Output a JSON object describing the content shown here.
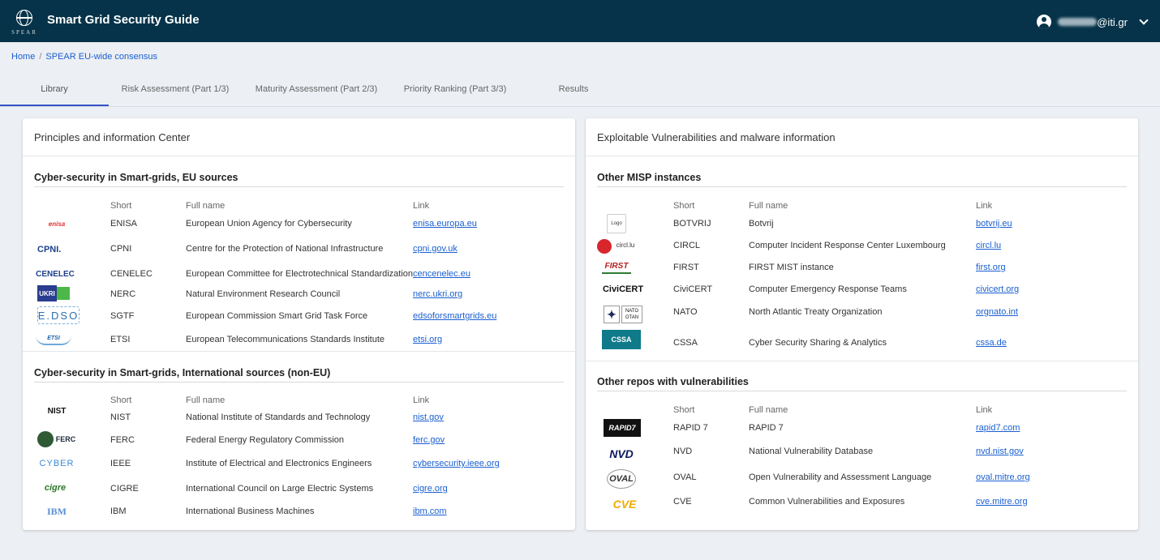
{
  "header": {
    "title": "Smart Grid Security Guide",
    "logo_text": "SPEAR",
    "user_suffix": "@iti.gr"
  },
  "breadcrumb": {
    "home": "Home",
    "separator": "/",
    "current": "SPEAR EU-wide consensus"
  },
  "tabs": [
    {
      "label": "Library"
    },
    {
      "label": "Risk Assessment (Part 1/3)"
    },
    {
      "label": "Maturity Assessment (Part 2/3)"
    },
    {
      "label": "Priority Ranking (Part 3/3)"
    },
    {
      "label": "Results"
    }
  ],
  "columns": {
    "short": "Short",
    "full": "Full name",
    "link": "Link"
  },
  "left_card": {
    "title": "Principles and information Center",
    "sections": [
      {
        "title": "Cyber-security in Smart-grids, EU sources",
        "rows": [
          {
            "logo": "enisa",
            "short": "ENISA",
            "full": "European Union Agency for Cybersecurity",
            "link": "enisa.europa.eu"
          },
          {
            "logo": "CPNI.",
            "short": "CPNI",
            "full": "Centre for the Protection of National Infrastructure",
            "link": "cpni.gov.uk"
          },
          {
            "logo": "CENELEC",
            "short": "CENELEC",
            "full": "European Committee for Electrotechnical Standardization",
            "link": "cencenelec.eu"
          },
          {
            "logo": "UKRI",
            "short": "NERC",
            "full": "Natural Environment Research Council",
            "link": "nerc.ukri.org"
          },
          {
            "logo": "E.DSO",
            "short": "SGTF",
            "full": "European Commission Smart Grid Task Force",
            "link": "edsoforsmartgrids.eu"
          },
          {
            "logo": "ETSI",
            "short": "ETSI",
            "full": "European Telecommunications Standards Institute",
            "link": "etsi.org"
          }
        ]
      },
      {
        "title": "Cyber-security in Smart-grids, International sources (non-EU)",
        "rows": [
          {
            "logo": "NIST",
            "short": "NIST",
            "full": "National Institute of Standards and Technology",
            "link": "nist.gov"
          },
          {
            "logo": "FERC",
            "short": "FERC",
            "full": "Federal Energy Regulatory Commission",
            "link": "ferc.gov"
          },
          {
            "logo": "CYBER",
            "short": "IEEE",
            "full": "Institute of Electrical and Electronics Engineers",
            "link": "cybersecurity.ieee.org"
          },
          {
            "logo": "cigre",
            "short": "CIGRE",
            "full": "International Council on Large Electric Systems",
            "link": "cigre.org"
          },
          {
            "logo": "IBM",
            "short": "IBM",
            "full": "International Business Machines",
            "link": "ibm.com"
          }
        ]
      }
    ]
  },
  "right_card": {
    "title": "Exploitable Vulnerabilities and malware information",
    "sections": [
      {
        "title": "Other MISP instances",
        "rows": [
          {
            "logo": "Logo",
            "short": "BOTVRIJ",
            "full": "Botvrij",
            "link": "botvrij.eu"
          },
          {
            "logo": "circl.lu",
            "short": "CIRCL",
            "full": "Computer Incident Response Center Luxembourg",
            "link": "circl.lu"
          },
          {
            "logo": "FIRST",
            "short": "FIRST",
            "full": "FIRST MIST instance",
            "link": "first.org"
          },
          {
            "logo": "CiviCERT",
            "short": "CiviCERT",
            "full": "Computer Emergency Response Teams",
            "link": "civicert.org"
          },
          {
            "logo": "NATO OTAN",
            "short": "NATO",
            "full": "North Atlantic Treaty Organization",
            "link": "orgnato.int"
          },
          {
            "logo": "CSSA",
            "short": "CSSA",
            "full": "Cyber Security Sharing & Analytics",
            "link": "cssa.de"
          }
        ]
      },
      {
        "title": "Other repos with vulnerabilities",
        "rows": [
          {
            "logo": "RAPID7",
            "short": "RAPID 7",
            "full": "RAPID 7",
            "link": "rapid7.com"
          },
          {
            "logo": "NVD",
            "short": "NVD",
            "full": "National Vulnerability Database",
            "link": "nvd.nist.gov"
          },
          {
            "logo": "OVAL",
            "short": "OVAL",
            "full": "Open Vulnerability and Assessment Language",
            "link": "oval.mitre.org"
          },
          {
            "logo": "CVE",
            "short": "CVE",
            "full": "Common Vulnerabilities and Exposures",
            "link": "cve.mitre.org"
          }
        ]
      }
    ]
  }
}
